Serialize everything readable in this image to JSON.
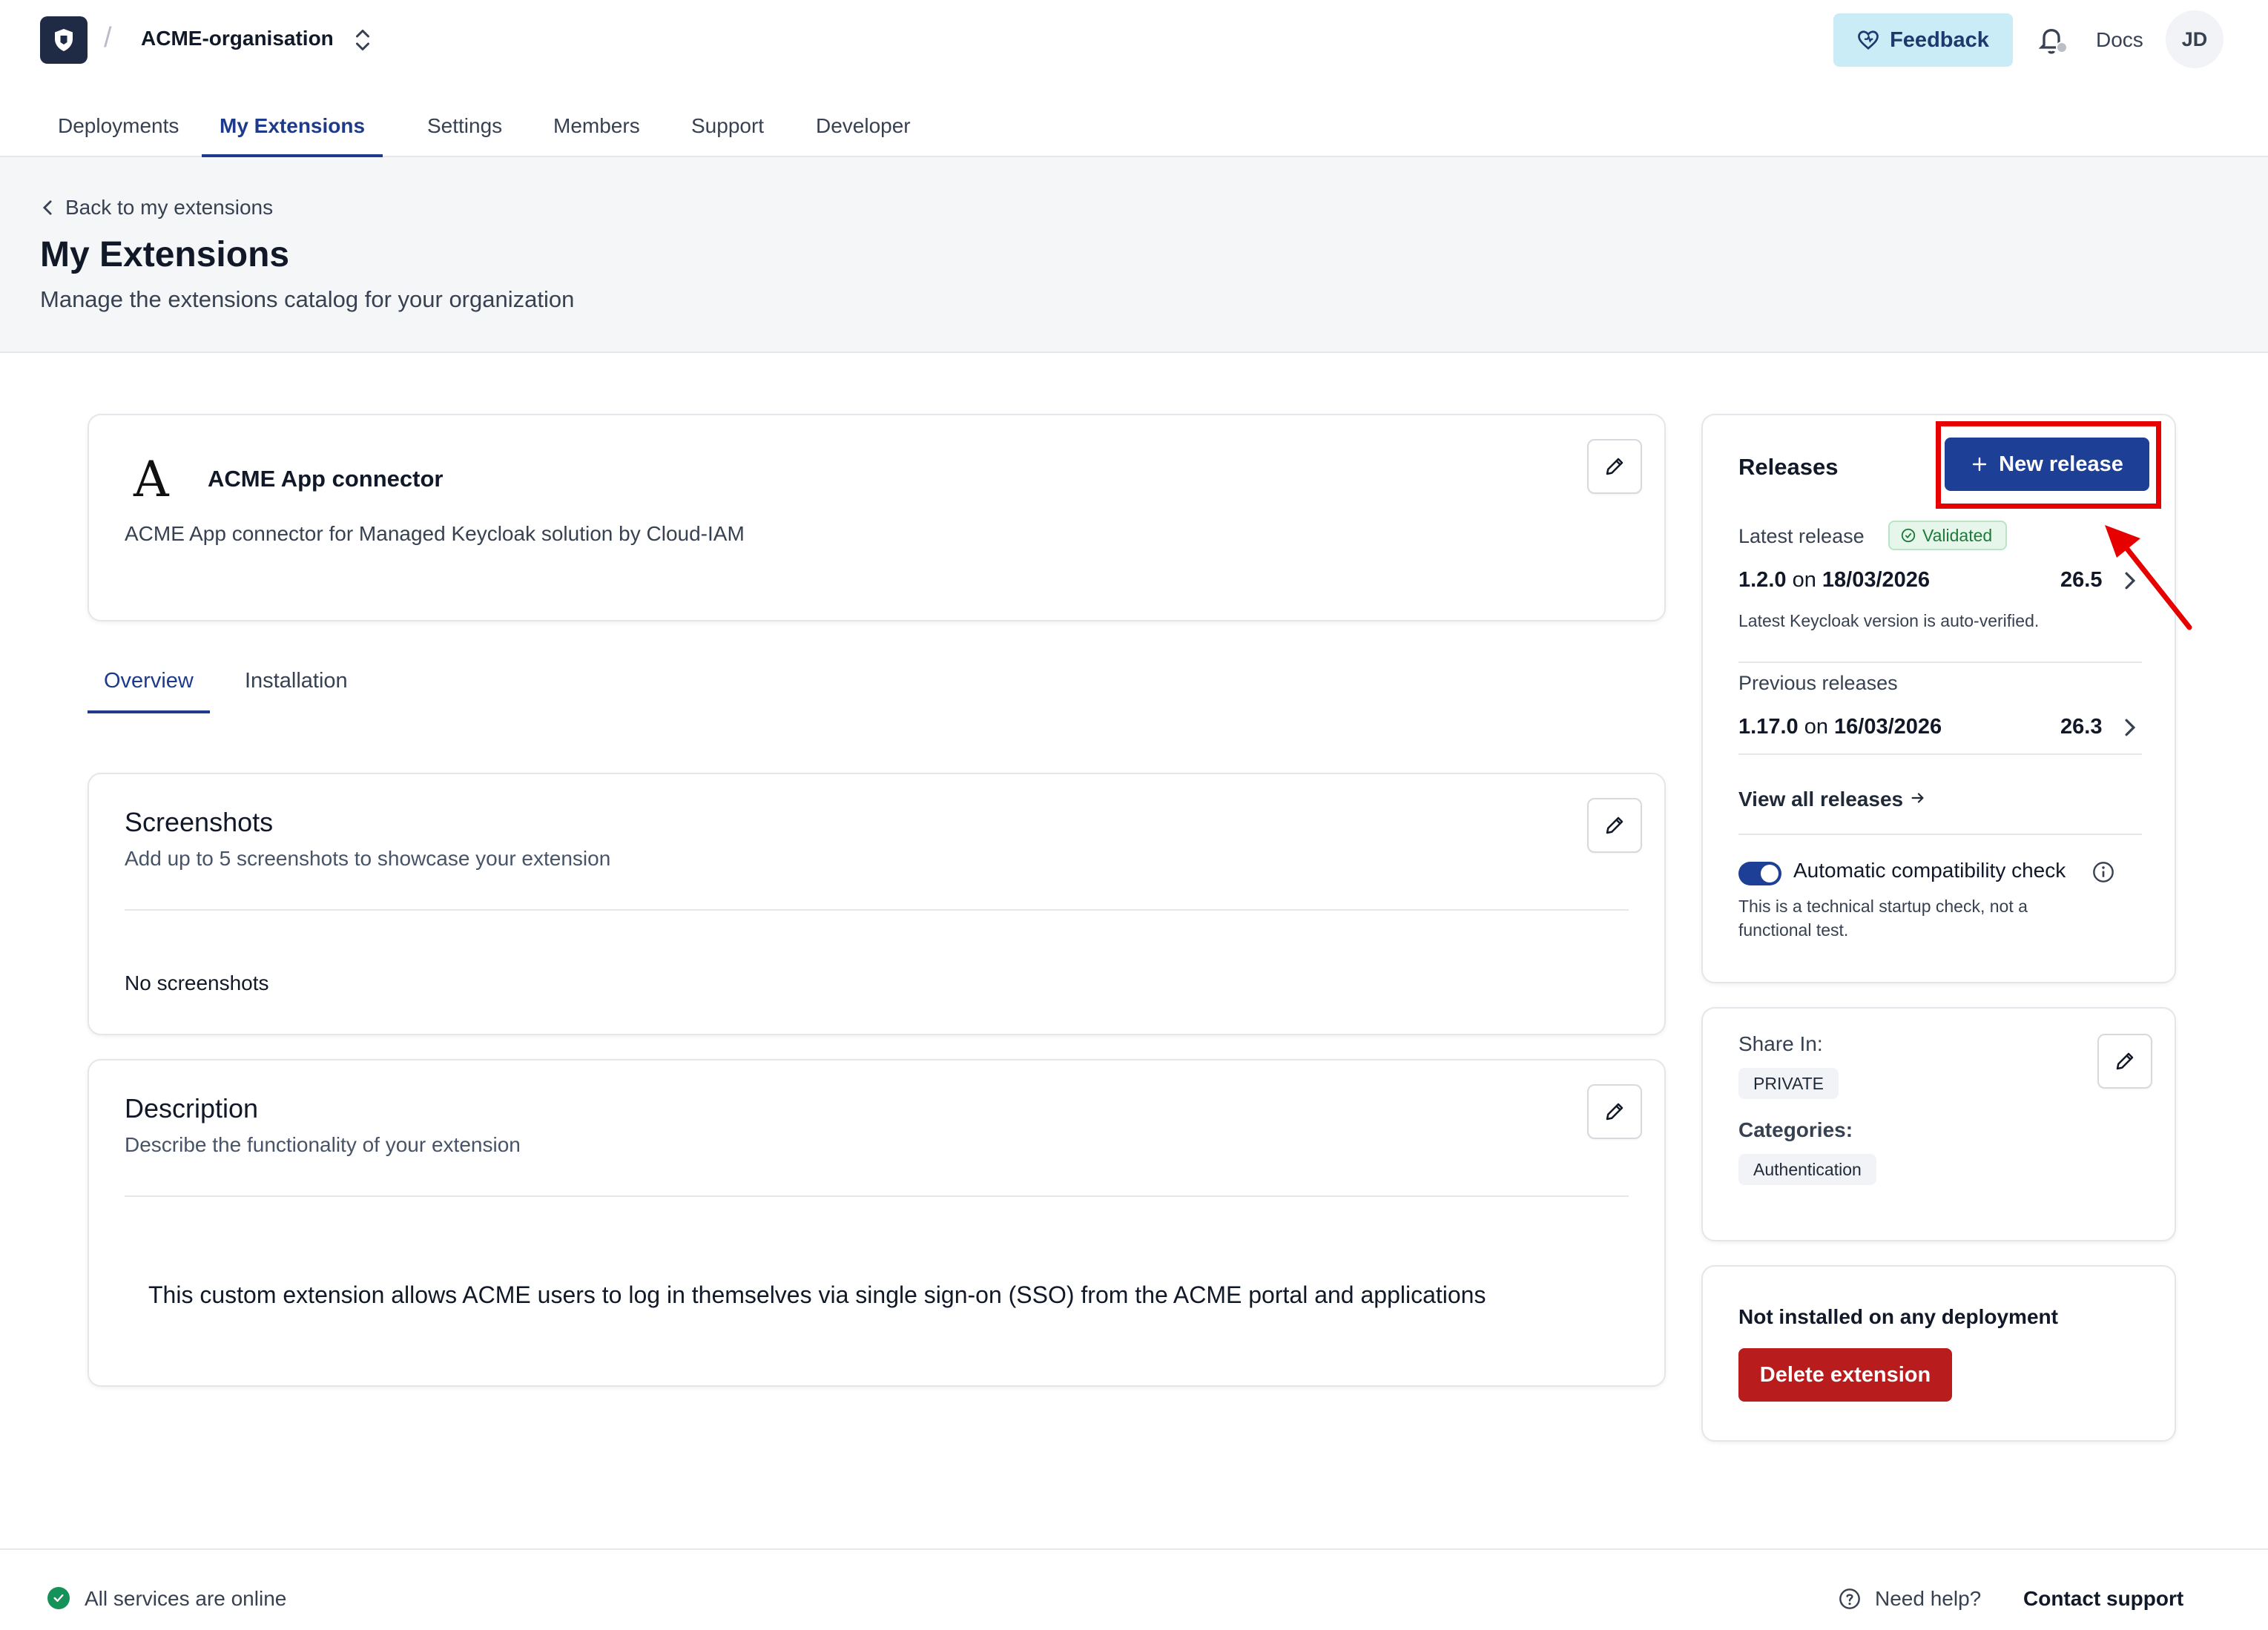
{
  "topbar": {
    "org_name": "ACME-organisation",
    "feedback_label": "Feedback",
    "docs_label": "Docs",
    "avatar_initials": "JD"
  },
  "nav": {
    "items": [
      "Deployments",
      "My Extensions",
      "Settings",
      "Members",
      "Support",
      "Developer"
    ],
    "active": "My Extensions"
  },
  "header": {
    "back_label": "Back to my extensions",
    "title": "My Extensions",
    "subtitle": "Manage the extensions catalog for your organization"
  },
  "extension": {
    "logo_letter": "A",
    "name": "ACME App connector",
    "description": "ACME App connector for Managed Keycloak solution by Cloud-IAM"
  },
  "subtabs": {
    "items": [
      "Overview",
      "Installation"
    ],
    "active": "Overview"
  },
  "screenshots": {
    "title": "Screenshots",
    "subtitle": "Add up to 5 screenshots to showcase your extension",
    "empty_text": "No screenshots"
  },
  "description": {
    "title": "Description",
    "subtitle": "Describe the functionality of your extension",
    "body": "This custom extension allows ACME users to log in themselves via single sign-on (SSO) from the ACME portal and applications"
  },
  "releases": {
    "title": "Releases",
    "new_release_label": "New release",
    "latest_label": "Latest release",
    "validated_badge": "Validated",
    "latest": {
      "version": "1.2.0",
      "on": "on",
      "date": "18/03/2026",
      "keycloak": "26.5"
    },
    "latest_note": "Latest Keycloak version is auto-verified.",
    "previous_label": "Previous releases",
    "previous": {
      "version": "1.17.0",
      "on": "on",
      "date": "16/03/2026",
      "keycloak": "26.3"
    },
    "view_all_label": "View all releases",
    "compat_label": "Automatic compatibility check",
    "compat_enabled": true,
    "compat_note": "This is a technical startup check, not a functional test."
  },
  "sharing": {
    "share_label": "Share In:",
    "share_value": "PRIVATE",
    "categories_label": "Categories:",
    "categories": [
      "Authentication"
    ]
  },
  "danger": {
    "status_text": "Not installed on any deployment",
    "delete_label": "Delete extension"
  },
  "footer": {
    "status_text": "All services are online",
    "help_text": "Need help?",
    "contact_label": "Contact support"
  },
  "colors": {
    "primary": "#1d3f96",
    "danger": "#b91c1c",
    "success": "#15925a",
    "highlight": "#e60000",
    "feedback_bg": "#c9ecf6"
  }
}
